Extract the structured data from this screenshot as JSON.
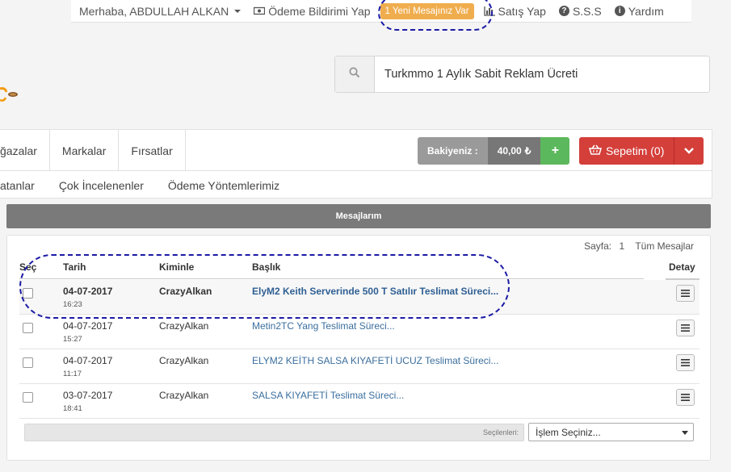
{
  "topbar": {
    "user_greeting": "Merhaba, ABDULLAH ALKAN",
    "payment_notice": "Ödeme Bildirimi Yap",
    "new_message_badge": "1 Yeni Mesajınız Var",
    "sell": "Satış Yap",
    "faq": "S.S.S",
    "help": "Yardım"
  },
  "search": {
    "value": "Turkmmo 1 Aylık Sabit Reklam Ücreti"
  },
  "nav": {
    "row1": [
      "ğazalar",
      "Markalar",
      "Fırsatlar"
    ],
    "row2": [
      "atanlar",
      "Çok İncelenenler",
      "Ödeme Yöntemlerimiz"
    ]
  },
  "balance": {
    "label": "Bakiyeniz :",
    "value": "40,00",
    "currency": "₺",
    "add": "+"
  },
  "cart": {
    "label": "Sepetim (0)"
  },
  "messages": {
    "header": "Mesajlarım",
    "page_label": "Sayfa:",
    "page_number": "1",
    "all_messages": "Tüm Mesajlar",
    "columns": {
      "select": "Seç",
      "date": "Tarih",
      "with": "Kiminle",
      "subject": "Başlık",
      "detail": "Detay"
    },
    "rows": [
      {
        "date": "04-07-2017",
        "time": "16:23",
        "with": "CrazyAlkan",
        "subject": "ElyM2 Keith Serverinde 500 T Satılır Teslimat Süreci..."
      },
      {
        "date": "04-07-2017",
        "time": "15:27",
        "with": "CrazyAlkan",
        "subject": "Metin2TC Yang Teslimat Süreci..."
      },
      {
        "date": "04-07-2017",
        "time": "11:17",
        "with": "CrazyAlkan",
        "subject": "ELYM2 KEİTH SALSA KIYAFETİ UCUZ Teslimat Süreci..."
      },
      {
        "date": "03-07-2017",
        "time": "18:41",
        "with": "CrazyAlkan",
        "subject": "SALSA KIYAFETİ Teslimat Süreci..."
      }
    ],
    "selected_label": "Seçilenleri:",
    "action_select": "İşlem Seçiniz..."
  },
  "colors": {
    "badge": "#f0ad4e",
    "cart": "#d43f3a",
    "add": "#5cb85c",
    "header_gray": "#7a7a7a",
    "link": "#3a6e9e",
    "annotation": "#1a1aa6"
  }
}
